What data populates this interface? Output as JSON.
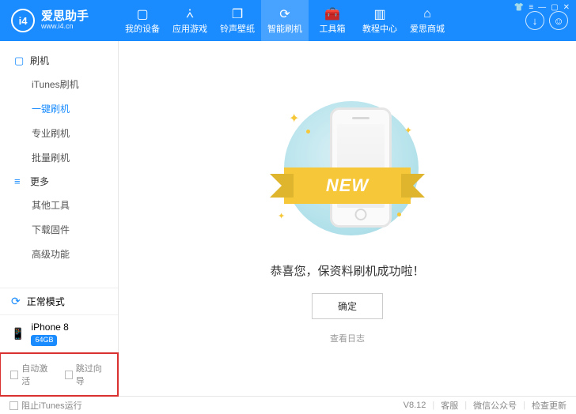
{
  "app": {
    "name": "爱思助手",
    "url": "www.i4.cn",
    "logo_text": "i4"
  },
  "nav": [
    {
      "label": "我的设备",
      "icon": "▢"
    },
    {
      "label": "应用游戏",
      "icon": "⩑"
    },
    {
      "label": "铃声壁纸",
      "icon": "❐"
    },
    {
      "label": "智能刷机",
      "icon": "⟳",
      "active": true
    },
    {
      "label": "工具箱",
      "icon": "🧰"
    },
    {
      "label": "教程中心",
      "icon": "▥"
    },
    {
      "label": "爱思商城",
      "icon": "⌂"
    }
  ],
  "sidebar": {
    "groups": [
      {
        "title": "刷机",
        "icon": "▢",
        "items": [
          {
            "label": "iTunes刷机"
          },
          {
            "label": "一键刷机",
            "active": true
          },
          {
            "label": "专业刷机"
          },
          {
            "label": "批量刷机"
          }
        ]
      },
      {
        "title": "更多",
        "icon": "≡",
        "items": [
          {
            "label": "其他工具"
          },
          {
            "label": "下载固件"
          },
          {
            "label": "高级功能"
          }
        ]
      }
    ],
    "mode_label": "正常模式",
    "device": {
      "name": "iPhone 8",
      "storage": "64GB"
    },
    "checkboxes": [
      {
        "label": "自动激活"
      },
      {
        "label": "跳过向导"
      }
    ]
  },
  "main": {
    "ribbon_text": "NEW",
    "success_message": "恭喜您，保资料刷机成功啦！",
    "ok_button": "确定",
    "log_link": "查看日志"
  },
  "footer": {
    "block_itunes": "阻止iTunes运行",
    "version": "V8.12",
    "links": [
      "客服",
      "微信公众号",
      "检查更新"
    ]
  },
  "window_controls": [
    "👕",
    "≡",
    "—",
    "▢",
    "✕"
  ]
}
